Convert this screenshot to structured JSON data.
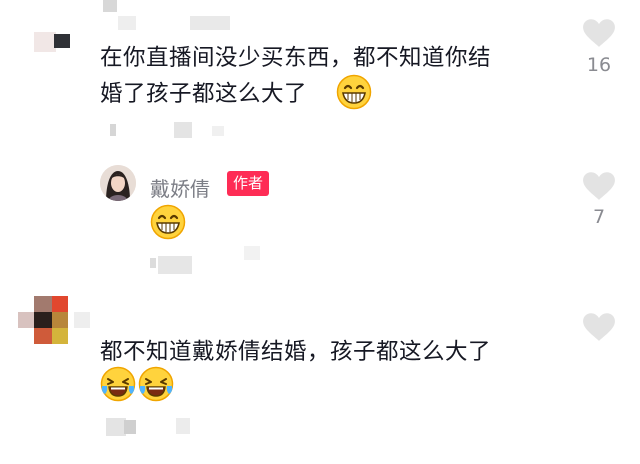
{
  "comments": [
    {
      "text_line1": "在你直播间没少买东西，都不知道你结",
      "text_line2": "婚了孩子都这么大了",
      "emoji": "grinning-face",
      "likes": "16"
    },
    {
      "username": "戴娇倩",
      "badge": "作者",
      "emoji": "grinning-face",
      "likes": "7"
    },
    {
      "text_line1": "都不知道戴娇倩结婚，孩子都这么大了",
      "emojis": [
        "crying-laughing-face",
        "crying-laughing-face"
      ]
    }
  ],
  "icons": {
    "like": "heart-icon"
  },
  "colors": {
    "author_badge": "#fe2c55",
    "heart": "#e3e3e3",
    "text": "#161823",
    "muted": "#8a8b91"
  }
}
